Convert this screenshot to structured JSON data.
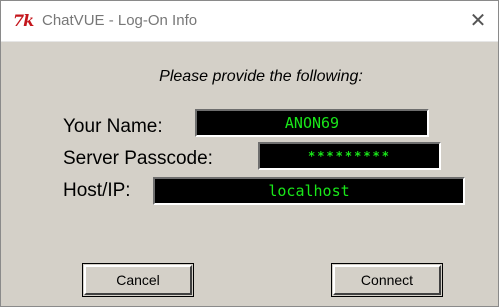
{
  "window": {
    "icon_text": "7k",
    "title": "ChatVUE - Log-On Info",
    "close_glyph": "✕"
  },
  "dialog": {
    "prompt": "Please provide the following:",
    "fields": {
      "name": {
        "label": "Your Name:",
        "value": "ANON69"
      },
      "passcode": {
        "label": "Server Passcode:",
        "value": "*********"
      },
      "host": {
        "label": "Host/IP:",
        "value": "localhost"
      }
    },
    "buttons": {
      "cancel": "Cancel",
      "connect": "Connect"
    }
  },
  "colors": {
    "dialog_bg": "#d4d0c8",
    "field_bg": "#000000",
    "field_text": "#19e619",
    "icon_red": "#c4161c"
  }
}
